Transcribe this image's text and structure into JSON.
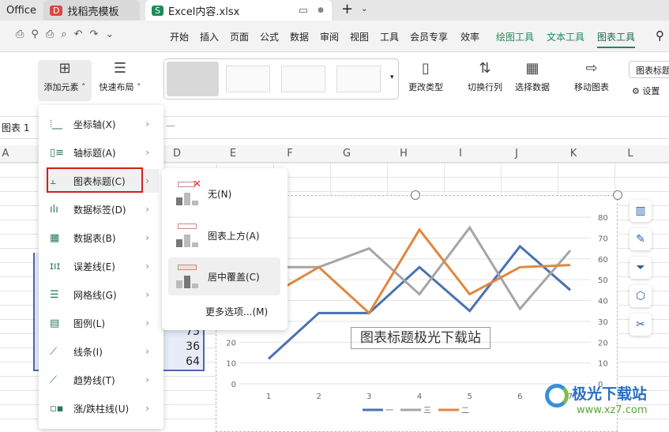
{
  "tabs": [
    {
      "label": "Office"
    },
    {
      "label": "找稻壳模板"
    },
    {
      "label": "Excel内容.xlsx",
      "active": true
    }
  ],
  "menu_items": [
    "开始",
    "插入",
    "页面",
    "公式",
    "数据",
    "审阅",
    "视图",
    "工具",
    "会员专享",
    "效率",
    "绘图工具",
    "文本工具",
    "图表工具"
  ],
  "ribbon": {
    "add_element": "添加元素",
    "quick_layout": "快速布局",
    "change_type": "更改类型",
    "switch_rowcol": "切换行列",
    "select_data": "选择数据",
    "move_chart": "移动图表",
    "chart_title_dropdown": "图表标题",
    "settings": "设置"
  },
  "name_box": "图表 1",
  "columns": [
    "A",
    "D",
    "E",
    "F",
    "G",
    "H",
    "I",
    "J",
    "K",
    "L"
  ],
  "cells": [
    "75",
    "36",
    "64"
  ],
  "element_menu": [
    {
      "label": "坐标轴(X)",
      "icon": "axis-icon"
    },
    {
      "label": "轴标题(A)",
      "icon": "axis-title-icon"
    },
    {
      "label": "图表标题(C)",
      "icon": "chart-title-icon",
      "highlighted": true
    },
    {
      "label": "数据标签(D)",
      "icon": "data-label-icon"
    },
    {
      "label": "数据表(B)",
      "icon": "data-table-icon"
    },
    {
      "label": "误差线(E)",
      "icon": "error-bar-icon"
    },
    {
      "label": "网格线(G)",
      "icon": "gridline-icon"
    },
    {
      "label": "图例(L)",
      "icon": "legend-icon"
    },
    {
      "label": "线条(I)",
      "icon": "lines-icon"
    },
    {
      "label": "趋势线(T)",
      "icon": "trendline-icon"
    },
    {
      "label": "涨/跌柱线(U)",
      "icon": "updown-bar-icon"
    }
  ],
  "title_submenu": [
    {
      "label": "无(N)"
    },
    {
      "label": "图表上方(A)"
    },
    {
      "label": "居中覆盖(C)",
      "hovered": true
    },
    {
      "label": "更多选项...(M)"
    }
  ],
  "chart_data": {
    "type": "line",
    "title": "图表标题极光下载站",
    "categories": [
      1,
      2,
      3,
      4,
      5,
      6,
      7
    ],
    "ylim": [
      0,
      80
    ],
    "yticks": [
      0,
      10,
      20,
      30,
      40,
      50,
      60,
      70,
      80
    ],
    "grid": true,
    "legend": "bottom",
    "series": [
      {
        "name": "一",
        "color": "#4a72b0",
        "values": [
          12,
          34,
          34,
          56,
          35,
          66,
          45
        ]
      },
      {
        "name": "三",
        "color": "#a5a5a5",
        "values": [
          56,
          56,
          65,
          43,
          75,
          36,
          64
        ]
      },
      {
        "name": "二",
        "color": "#e0873f",
        "values": [
          42,
          56,
          34,
          74,
          43,
          56,
          57
        ]
      }
    ]
  },
  "watermark": {
    "text": "极光下载站",
    "url": "www.xz7.com"
  }
}
